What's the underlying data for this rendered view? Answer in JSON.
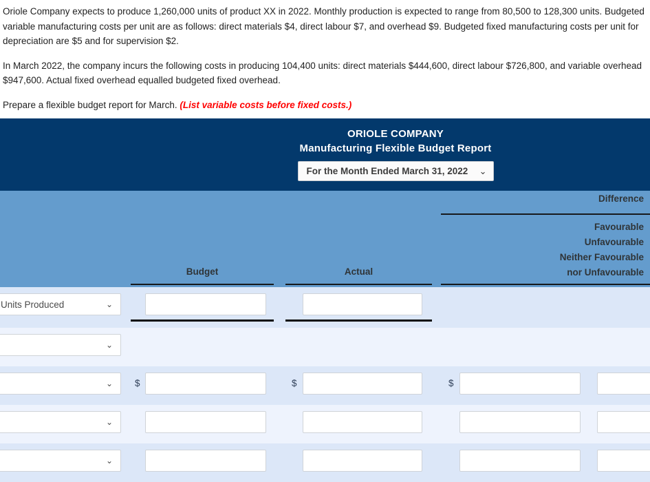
{
  "problem": {
    "paragraph1": "Oriole Company expects to produce 1,260,000 units of product XX in 2022. Monthly production is expected to range from 80,500 to 128,300 units. Budgeted variable manufacturing costs per unit are as follows: direct materials $4, direct labour $7, and overhead $9. Budgeted fixed manufacturing costs per unit for depreciation are $5 and for supervision $2.",
    "paragraph2": "In March 2022, the company incurs the following costs in producing 104,400 units: direct materials $444,600, direct labour $726,800, and variable overhead $947,600. Actual fixed overhead equalled budgeted fixed overhead.",
    "instruction": "Prepare a flexible budget report for March.",
    "hint": "(List variable costs before fixed costs.)"
  },
  "report": {
    "company": "ORIOLE COMPANY",
    "title": "Manufacturing Flexible Budget Report",
    "period_select": {
      "value": "For the Month Ended March 31, 2022",
      "chevron": "⌄"
    },
    "columns": {
      "budget": "Budget",
      "actual": "Actual",
      "difference": "Difference",
      "fav_line1": "Favourable",
      "fav_line2": "Unfavourable",
      "fav_line3": "Neither Favourable",
      "fav_line4": "nor Unfavourable"
    },
    "rows": [
      {
        "label": "Units Produced",
        "chevron": "⌄",
        "currency": "",
        "inputs": [
          "",
          ""
        ]
      },
      {
        "label": "",
        "chevron": "⌄",
        "currency": "",
        "inputs": []
      },
      {
        "label": "",
        "chevron": "⌄",
        "currency": "$",
        "inputs": [
          "",
          "",
          "",
          ""
        ]
      },
      {
        "label": "",
        "chevron": "⌄",
        "currency": "",
        "inputs": [
          "",
          "",
          "",
          ""
        ]
      },
      {
        "label": "",
        "chevron": "⌄",
        "currency": "",
        "inputs": [
          "",
          "",
          "",
          ""
        ]
      }
    ]
  },
  "colors": {
    "header_navy": "#03396c",
    "column_band_blue": "#649ccd",
    "row_shade_a": "#dce7f8",
    "row_shade_b": "#eef3fd",
    "hint_red": "#ff0000"
  }
}
